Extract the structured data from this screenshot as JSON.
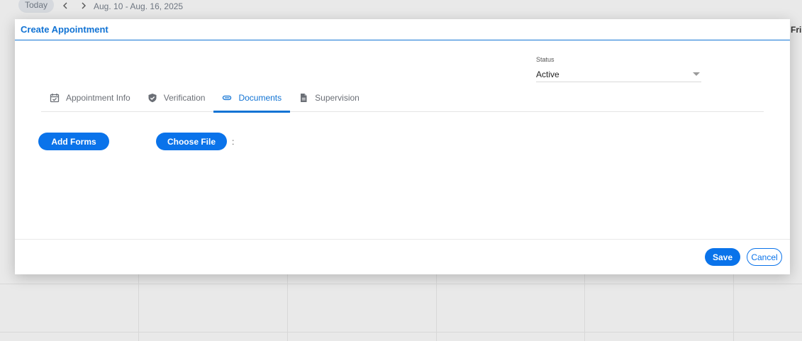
{
  "calendar": {
    "today_label": "Today",
    "date_range": "Aug. 10 - Aug. 16, 2025",
    "day_label_fri": "Fri"
  },
  "modal": {
    "title": "Create Appointment",
    "status": {
      "label": "Status",
      "value": "Active"
    },
    "tabs": [
      {
        "label": "Appointment Info",
        "icon": "calendar-check-icon"
      },
      {
        "label": "Verification",
        "icon": "shield-check-icon"
      },
      {
        "label": "Documents",
        "icon": "paperclip-icon",
        "active": true
      },
      {
        "label": "Supervision",
        "icon": "document-icon"
      }
    ],
    "documents": {
      "add_forms_label": "Add Forms",
      "choose_file_label": "Choose File",
      "file_name": ":"
    },
    "footer": {
      "save_label": "Save",
      "cancel_label": "Cancel"
    }
  },
  "colors": {
    "accent": "#1173d4",
    "button": "#0a73ea"
  }
}
